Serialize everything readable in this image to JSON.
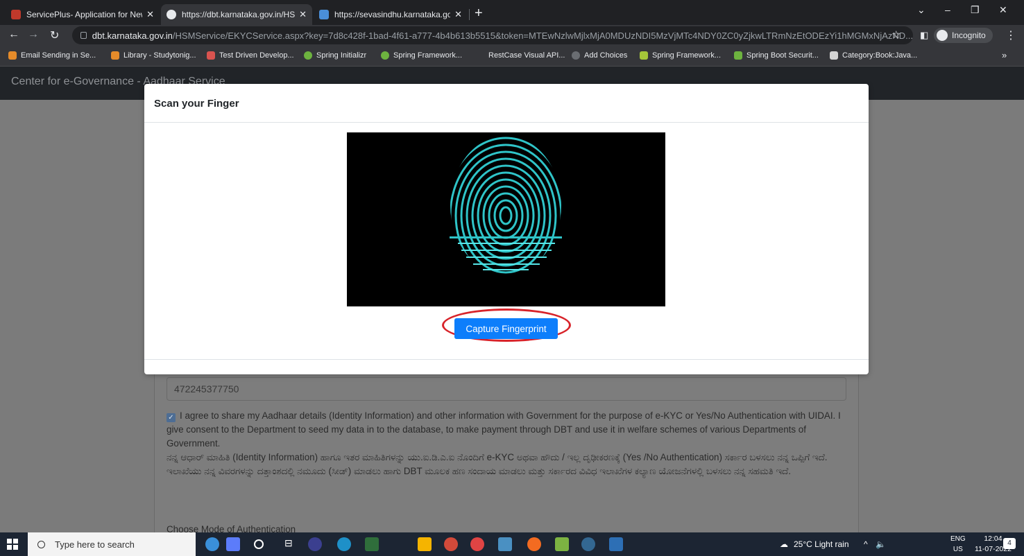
{
  "browser": {
    "tabs": [
      {
        "title": "ServicePlus- Application for New",
        "active": false
      },
      {
        "title": "https://dbt.karnataka.gov.in/HSM",
        "active": true
      },
      {
        "title": "https://sevasindhu.karnataka.gov",
        "active": false
      }
    ],
    "url_host": "dbt.karnataka.gov.in",
    "url_path": "/HSMService/EKYCService.aspx?key=7d8c428f-1bad-4f61-a777-4b4b613b5515&token=MTEwNzlwMjlxMjA0MDUzNDI5MzVjMTc4NDY0ZC0yZjkwLTRmNzEtODEzYi1hMGMxNjAzND...",
    "incognito_label": "Incognito",
    "bookmarks": [
      "Email Sending in Se...",
      "Library - Studytonig...",
      "Test Driven Develop...",
      "Spring Initializr",
      "Spring Framework...",
      "RestCase Visual API...",
      "Add Choices",
      "Spring Framework...",
      "Spring Boot Securit...",
      "Category:Book:Java..."
    ]
  },
  "page": {
    "brand": "Center for e-Governance - Aadhaar Service",
    "aadhaar_number": "472245377750",
    "consent_en": "I agree to share my Aadhaar details (Identity Information) and other information with Government for the purpose of e-KYC or Yes/No Authentication with UIDAI. I give consent to the Department to seed my data in to the database, to make payment through DBT and use it in welfare schemes of various Departments of Government.",
    "consent_kn": "ನನ್ನ ಆಧಾರ್ ಮಾಹಿತಿ (Identity Information) ಹಾಗೂ ಇತರ ಮಾಹಿತಿಗಳನ್ನು ಯು.ಐ.ಡಿ.ಎ.ಐ ನೊಂದಿಗೆ e-KYC ಅಥವಾ ಹೌದು / ಇಲ್ಲ ದೃಢೀಕರಣಕ್ಕೆ (Yes /No Authentication) ಸರ್ಕಾರ ಬಳಸಲು ನನ್ನ ಒಪ್ಪಿಗೆ ಇದೆ. ಇಲಾಖೆಯು ನನ್ನ ವಿವರಗಳನ್ನು ದತ್ತಾಂಶದಲ್ಲಿ ನಮೂದು (ಸೀಡ್) ಮಾಡಲು ಹಾಗು DBT ಮೂಲಕ ಹಣ ಸಂದಾಯ ಮಾಡಲು ಮತ್ತು ಸರ್ಕಾರದ ವಿವಿಧ ಇಲಾಖೆಗಳ ಕಲ್ಯಾಣ ಯೋಜನೆಗಳಲ್ಲಿ ಬಳಸಲು ನನ್ನ ಸಹಮತಿ ಇದೆ.",
    "mode_label": "Choose Mode of Authentication"
  },
  "modal": {
    "title": "Scan your Finger",
    "capture_button": "Capture Fingerprint"
  },
  "taskbar": {
    "search_placeholder": "Type here to search",
    "weather": "25°C  Light rain",
    "lang_top": "ENG",
    "lang_bottom": "US",
    "time": "12:04",
    "date": "11-07-2022",
    "notifications": "4"
  }
}
